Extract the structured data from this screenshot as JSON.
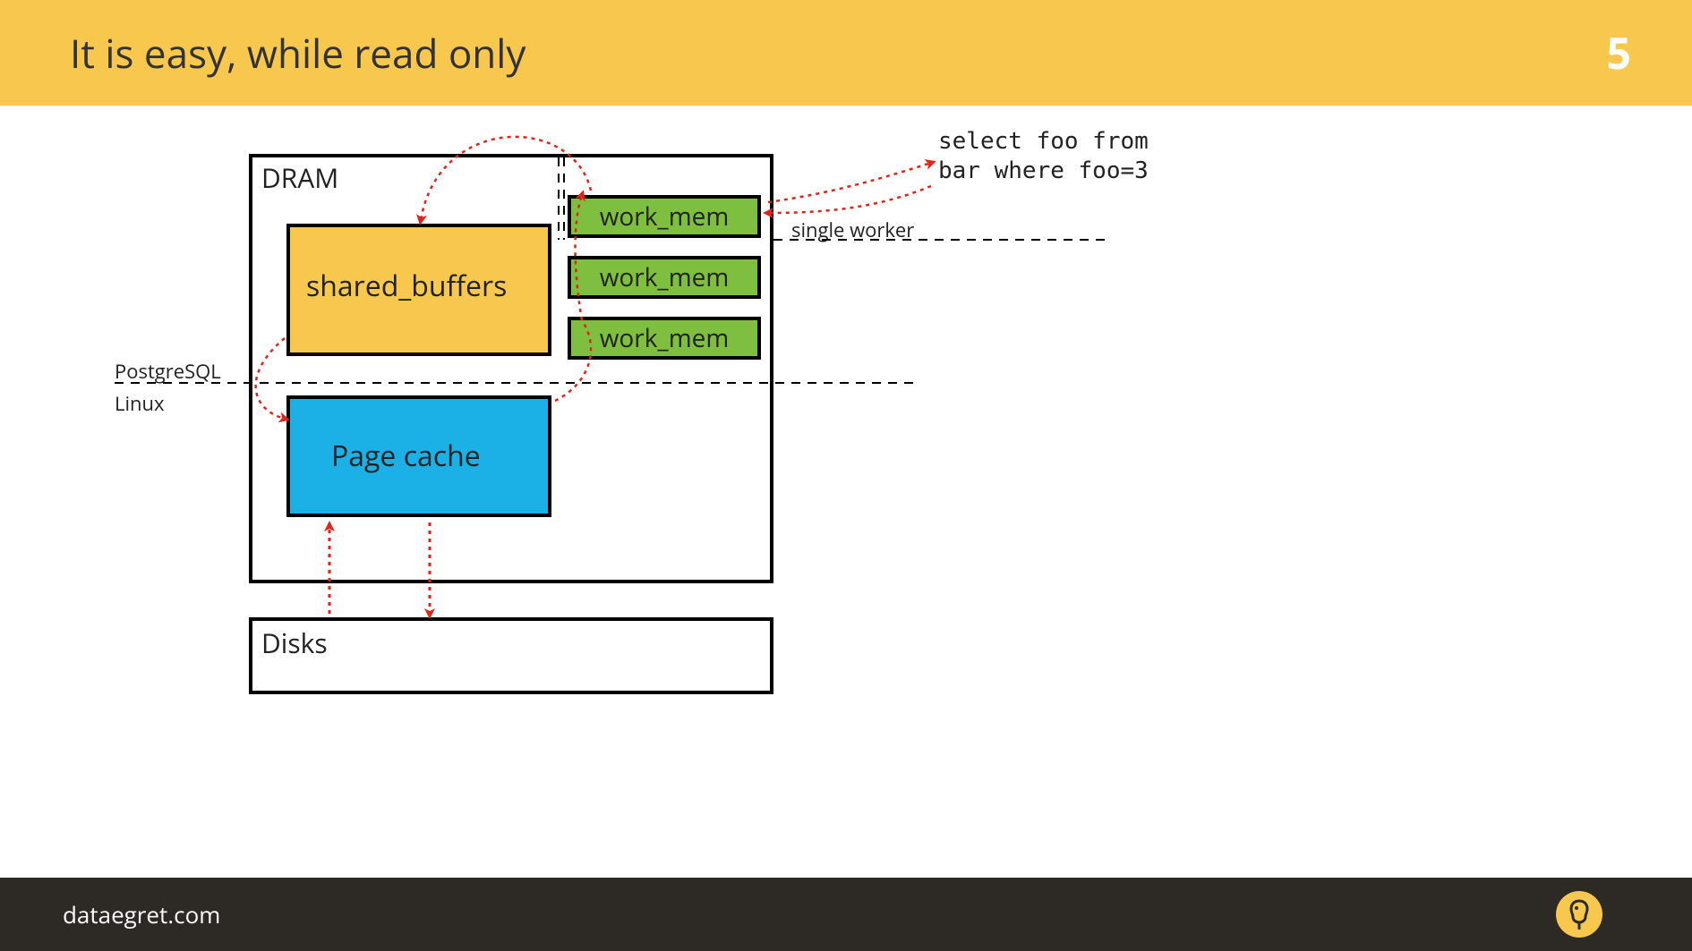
{
  "header": {
    "title": "It is easy, while read only",
    "slide_number": "5"
  },
  "footer": {
    "site": "dataegret.com"
  },
  "dram": {
    "label": "DRAM"
  },
  "shared_buffers": {
    "label": "shared_buffers"
  },
  "page_cache": {
    "label": "Page cache"
  },
  "work_mem": {
    "label1": "work_mem",
    "label2": "work_mem",
    "label3": "work_mem"
  },
  "disks": {
    "label": "Disks"
  },
  "sql": {
    "text": "select foo from\nbar where foo=3"
  },
  "labels": {
    "single_worker": "single worker",
    "postgresql": "PostgreSQL",
    "linux": "Linux"
  },
  "colors": {
    "accent": "#f8c84e",
    "green": "#7fbf3f",
    "blue": "#1bb1e7",
    "footer": "#2d2a26",
    "arrow": "#e2231a"
  }
}
